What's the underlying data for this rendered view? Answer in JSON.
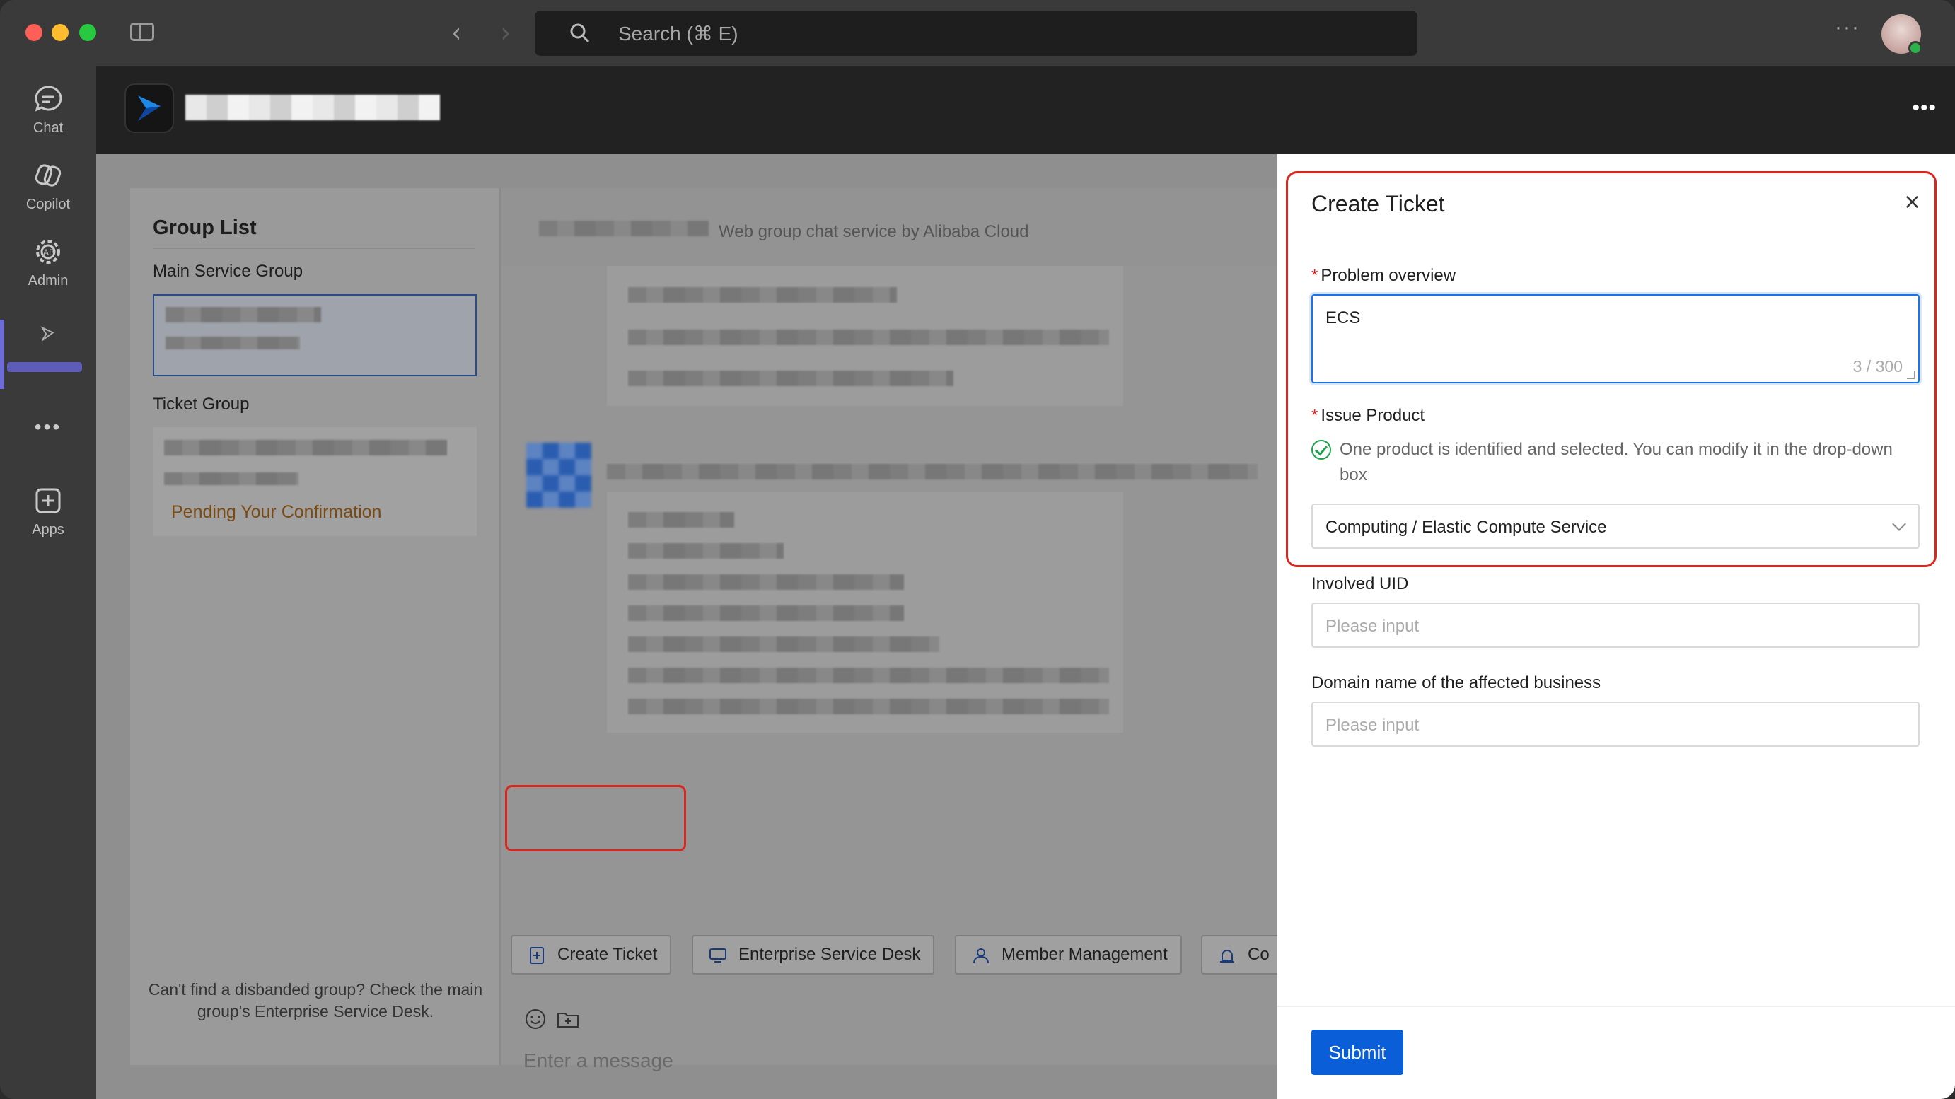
{
  "titlebar": {
    "search_placeholder": "Search (⌘ E)",
    "more": "···"
  },
  "rail": {
    "items": [
      {
        "label": "Chat",
        "icon": "chat-icon"
      },
      {
        "label": "Copilot",
        "icon": "copilot-icon"
      },
      {
        "label": "Admin",
        "icon": "admin-icon"
      },
      {
        "label": "",
        "icon": "app-logo-icon"
      },
      {
        "label": "Apps",
        "icon": "apps-add-icon"
      }
    ],
    "more": "•••"
  },
  "app_header": {
    "more": "•••"
  },
  "group_panel": {
    "title": "Group List",
    "main_group_label": "Main Service Group",
    "ticket_group_label": "Ticket Group",
    "ticket_status": "Pending Your Confirmation",
    "footnote": "Can't find a disbanded group? Check the main group's Enterprise Service Desk."
  },
  "chat": {
    "subtitle": "Web group chat service by Alibaba Cloud",
    "actions": [
      {
        "label": "Create Ticket",
        "icon": "ticket-add-icon"
      },
      {
        "label": "Enterprise Service Desk",
        "icon": "monitor-icon"
      },
      {
        "label": "Member Management",
        "icon": "user-icon"
      },
      {
        "label": "Co",
        "icon": "alarm-icon"
      }
    ],
    "input_placeholder": "Enter a message"
  },
  "drawer": {
    "title": "Create Ticket",
    "close": "×",
    "problem_label": "Problem overview",
    "problem_value": "ECS",
    "problem_count": "3 / 300",
    "product_label": "Issue Product",
    "product_notice": "One product is identified and selected. You can modify it in the drop-down box",
    "product_value": "Computing / Elastic Compute Service",
    "uid_label": "Involved UID",
    "uid_placeholder": "Please input",
    "domain_label": "Domain name of the affected business",
    "domain_placeholder": "Please input",
    "submit": "Submit"
  },
  "colors": {
    "accent": "#0a5ed7",
    "highlight": "#d9271e",
    "pending": "#7a4a13",
    "success": "#1aa34a"
  }
}
